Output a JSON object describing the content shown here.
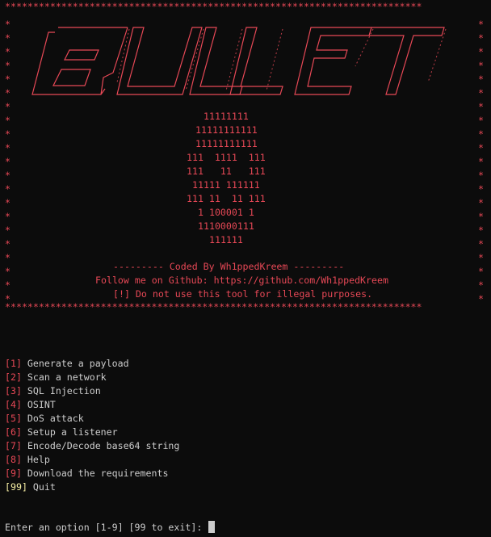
{
  "colors": {
    "background": "#0c0c0c",
    "text": "#cccccc",
    "banner_red": "#e74856",
    "quit_yellow": "#f9f1a5"
  },
  "banner": {
    "border_top": "**************************************************************************",
    "border_bottom": "**************************************************************************",
    "ascii_logo": "*      _______   __    __   __      __      _______  _________ *\n*     /  ___  \\ / /   / /  / /     / /     / _____/ /___  ___/ *\n*    / /__/ / / /   / /  / /     / /     / /__       / /     *\n*   / ___  <  / /   / /  / /     / /     / ___/     / /      *\n*  / /__/ / / /___/ /  / /___  / /___  / /____    / /       *\n* /______/ /_______/  /_____/ /_____/ /______/   /_/        *\n*                                                                          *",
    "skull": [
      "11111111",
      "11111111111",
      "11111111111",
      "111  1111  111",
      "111   11   111",
      "11111 111111",
      "111 11  11 111",
      "1 100001 1",
      "1110000111",
      "111111"
    ],
    "coded_by": "--------- Coded By Wh1ppedKreem ---------",
    "follow": "Follow me on Github: https://github.com/Wh1ppedKreem",
    "warning": "[!] Do not use this tool for illegal purposes."
  },
  "menu": [
    {
      "key": "[1]",
      "label": "Generate a payload"
    },
    {
      "key": "[2]",
      "label": "Scan a network"
    },
    {
      "key": "[3]",
      "label": "SQL Injection"
    },
    {
      "key": "[4]",
      "label": "OSINT"
    },
    {
      "key": "[5]",
      "label": "DoS attack"
    },
    {
      "key": "[6]",
      "label": "Setup a listener"
    },
    {
      "key": "[7]",
      "label": "Encode/Decode base64 string"
    },
    {
      "key": "[8]",
      "label": "Help"
    },
    {
      "key": "[9]",
      "label": "Download the requirements"
    },
    {
      "key": "[99]",
      "label": "Quit"
    }
  ],
  "prompt": {
    "text": "Enter an option [1-9] [99 to exit]: "
  }
}
